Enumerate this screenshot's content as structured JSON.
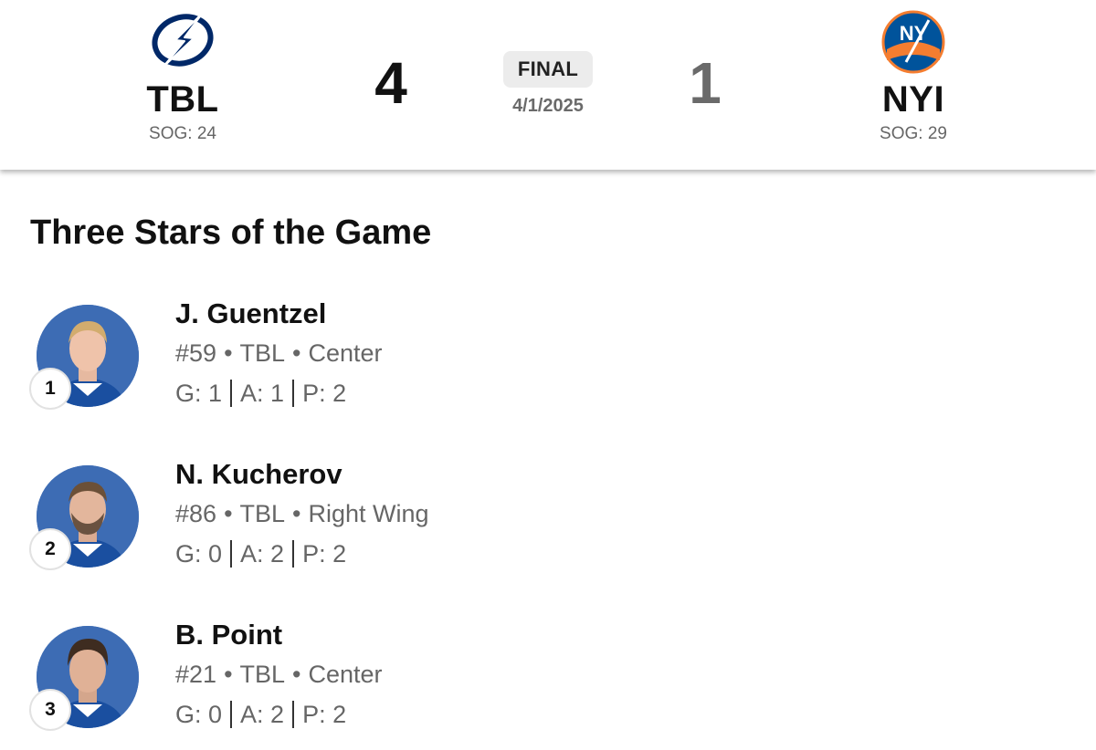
{
  "game": {
    "home": {
      "abbr": "TBL",
      "sog": "SOG: 24",
      "score": "4",
      "logo_icon": "lightning-bolt-logo",
      "color": "#002868"
    },
    "away": {
      "abbr": "NYI",
      "sog": "SOG: 29",
      "score": "1",
      "logo_icon": "islanders-logo",
      "color": "#00539b",
      "accent": "#f47d30"
    },
    "status": "FINAL",
    "date": "4/1/2025"
  },
  "section_title": "Three Stars of the Game",
  "stars": [
    {
      "rank": "1",
      "name": "J. Guentzel",
      "number": "#59",
      "team": "TBL",
      "position": "Center",
      "g": "G: 1",
      "a": "A: 1",
      "p": "P: 2"
    },
    {
      "rank": "2",
      "name": "N. Kucherov",
      "number": "#86",
      "team": "TBL",
      "position": "Right Wing",
      "g": "G: 0",
      "a": "A: 2",
      "p": "P: 2"
    },
    {
      "rank": "3",
      "name": "B. Point",
      "number": "#21",
      "team": "TBL",
      "position": "Center",
      "g": "G: 0",
      "a": "A: 2",
      "p": "P: 2"
    }
  ],
  "colors": {
    "avatar_bg": "#3d6cb4",
    "muted_text": "#666666",
    "pill_bg": "#ececec"
  }
}
